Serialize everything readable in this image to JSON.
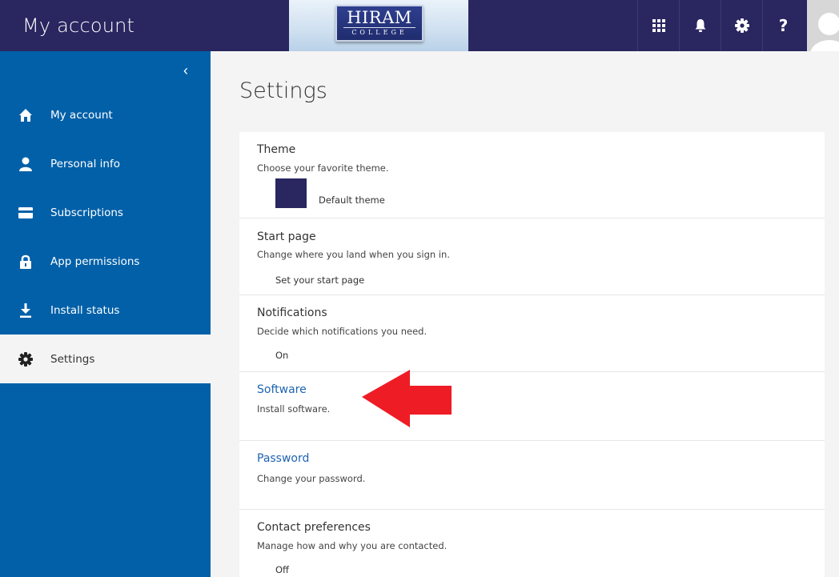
{
  "header": {
    "title": "My account",
    "logo": {
      "name": "HIRAM",
      "sub": "COLLEGE"
    },
    "icons": [
      "app-launcher-icon",
      "bell-icon",
      "gear-icon",
      "help-icon"
    ]
  },
  "sidebar": {
    "collapse_glyph": "‹",
    "items": [
      {
        "label": "My account",
        "icon": "home-icon"
      },
      {
        "label": "Personal info",
        "icon": "person-icon"
      },
      {
        "label": "Subscriptions",
        "icon": "card-icon"
      },
      {
        "label": "App permissions",
        "icon": "lock-icon"
      },
      {
        "label": "Install status",
        "icon": "download-icon"
      },
      {
        "label": "Settings",
        "icon": "gear-icon",
        "active": true
      }
    ]
  },
  "main": {
    "page_title": "Settings",
    "sections": {
      "theme": {
        "title": "Theme",
        "desc": "Choose your favorite theme.",
        "value": "Default theme",
        "swatch_color": "#292660"
      },
      "start_page": {
        "title": "Start page",
        "desc": "Change where you land when you sign in.",
        "value": "Set your start page"
      },
      "notifications": {
        "title": "Notifications",
        "desc": "Decide which notifications you need.",
        "value": "On"
      },
      "software": {
        "title": "Software",
        "desc": "Install software."
      },
      "password": {
        "title": "Password",
        "desc": "Change your password."
      },
      "contact": {
        "title": "Contact preferences",
        "desc": "Manage how and why you are contacted.",
        "value": "Off"
      }
    }
  },
  "colors": {
    "topbar": "#292660",
    "sidebar": "#0160a8",
    "link": "#1e63b0",
    "annotation_arrow": "#ee1c25"
  }
}
